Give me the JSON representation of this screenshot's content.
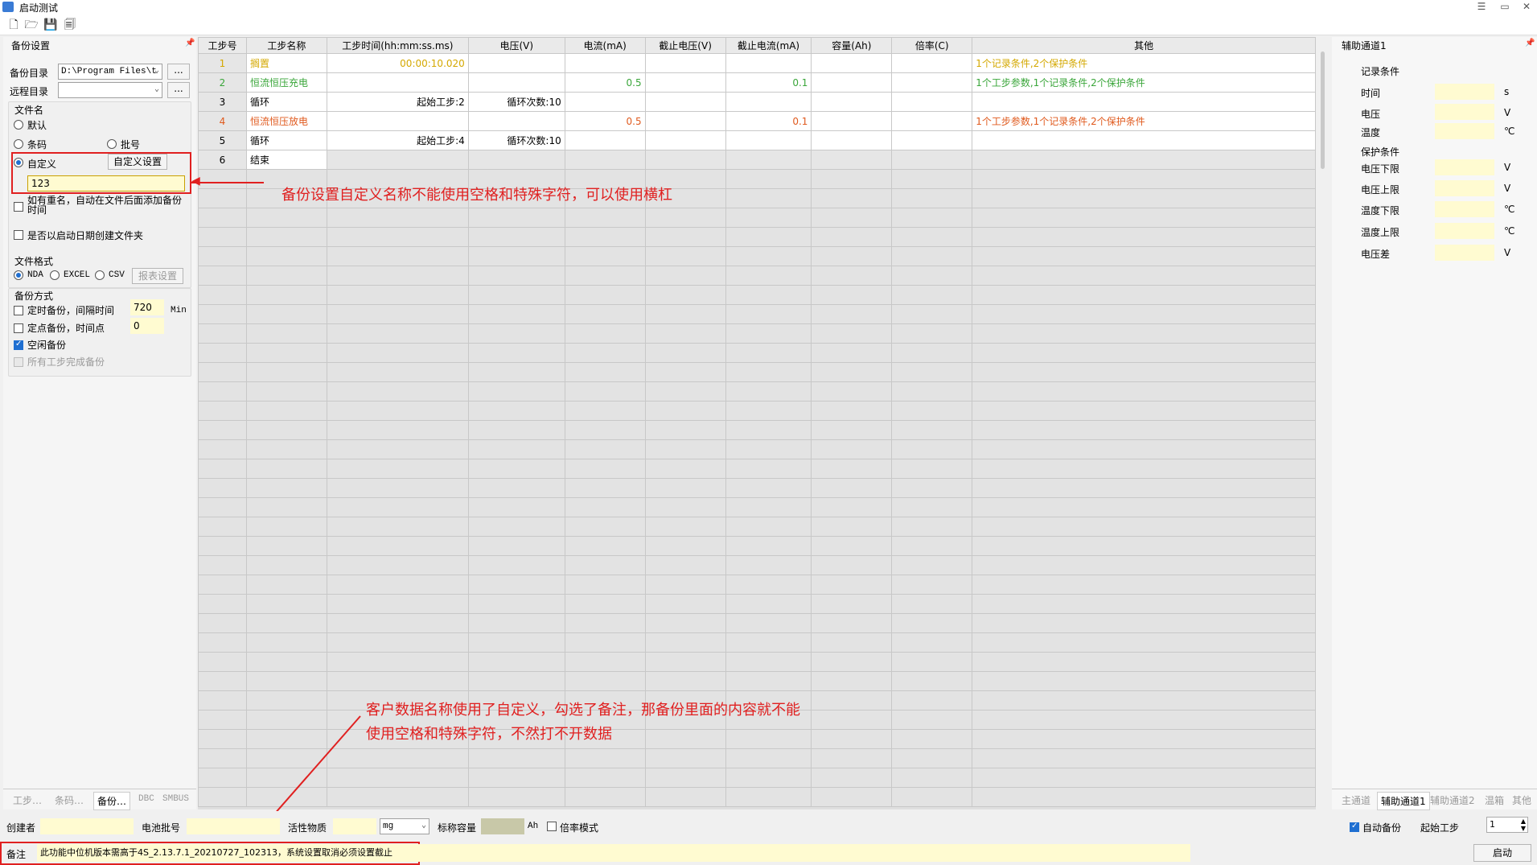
{
  "window": {
    "title": "启动测试",
    "controls": [
      "☰",
      "▭",
      "✕"
    ]
  },
  "toolbar": {
    "icons": [
      "new-icon",
      "open-icon",
      "save-icon",
      "save-all-icon"
    ]
  },
  "left": {
    "title": "备份设置",
    "pin": "📌",
    "backup_dir_label": "备份目录",
    "backup_dir_value": "D:\\Program Files\\t",
    "remote_dir_label": "远程目录",
    "remote_dir_value": "",
    "browse": "...",
    "filename_group": "文件名",
    "opt_default": "默认",
    "opt_barcode": "条码",
    "opt_batch": "批号",
    "opt_custom": "自定义",
    "custom_settings_btn": "自定义设置",
    "custom_value": "123",
    "rename_check": "如有重名，自动在文件后面添加备份时间",
    "date_folder_check": "是否以启动日期创建文件夹",
    "format_group": "文件格式",
    "fmt_nda": "NDA",
    "fmt_excel": "EXCEL",
    "fmt_csv": "CSV",
    "report_btn": "报表设置",
    "backup_mode_group": "备份方式",
    "timed_backup": "定时备份，间隔时间",
    "timed_value": "720",
    "timed_unit": "Min",
    "point_backup": "定点备份，时间点",
    "point_value": "0",
    "idle_backup": "空闲备份",
    "all_steps_backup": "所有工步完成备份",
    "tabs": [
      "工步…",
      "条码…",
      "备份…",
      "DBC",
      "SMBUS"
    ]
  },
  "grid": {
    "columns": [
      "工步号",
      "工步名称",
      "工步时间(hh:mm:ss.ms)",
      "电压(V)",
      "电流(mA)",
      "截止电压(V)",
      "截止电流(mA)",
      "容量(Ah)",
      "倍率(C)",
      "其他"
    ],
    "rows": [
      {
        "no": "1",
        "name": "搁置",
        "time": "00:00:10.020",
        "voltage": "",
        "current": "",
        "cut_v": "",
        "cut_i": "",
        "cap": "",
        "rate": "",
        "other": "1个记录条件,2个保护条件",
        "color": "#d4a800"
      },
      {
        "no": "2",
        "name": "恒流恒压充电",
        "time": "",
        "voltage": "",
        "current": "0.5",
        "cut_v": "",
        "cut_i": "0.1",
        "cap": "",
        "rate": "",
        "other": "1个工步参数,1个记录条件,2个保护条件",
        "color": "#3aa63a"
      },
      {
        "no": "3",
        "name": "循环",
        "time": "起始工步:2",
        "voltage": "循环次数:10",
        "current": "",
        "cut_v": "",
        "cut_i": "",
        "cap": "",
        "rate": "",
        "other": "",
        "color": "#000000"
      },
      {
        "no": "4",
        "name": "恒流恒压放电",
        "time": "",
        "voltage": "",
        "current": "0.5",
        "cut_v": "",
        "cut_i": "0.1",
        "cap": "",
        "rate": "",
        "other": "1个工步参数,1个记录条件,2个保护条件",
        "color": "#e05a1e"
      },
      {
        "no": "5",
        "name": "循环",
        "time": "起始工步:4",
        "voltage": "循环次数:10",
        "current": "",
        "cut_v": "",
        "cut_i": "",
        "cap": "",
        "rate": "",
        "other": "",
        "color": "#000000"
      },
      {
        "no": "6",
        "name": "结束",
        "time": "",
        "voltage": "",
        "current": "",
        "cut_v": "",
        "cut_i": "",
        "cap": "",
        "rate": "",
        "other": "",
        "color": "#000000"
      }
    ]
  },
  "annotations": {
    "note1": "备份设置自定义名称不能使用空格和特殊字符，可以使用横杠",
    "note2_line1": "客户数据名称使用了自定义，勾选了备注，那备份里面的内容就不能",
    "note2_line2": "使用空格和特殊字符，不然打不开数据"
  },
  "right": {
    "title": "辅助通道1",
    "record_cond": "记录条件",
    "time": "时间",
    "time_unit": "s",
    "voltage": "电压",
    "voltage_unit": "V",
    "temp": "温度",
    "temp_unit": "℃",
    "protect_cond": "保护条件",
    "v_low": "电压下限",
    "v_low_unit": "V",
    "v_high": "电压上限",
    "v_high_unit": "V",
    "t_low": "温度下限",
    "t_low_unit": "℃",
    "t_high": "温度上限",
    "t_high_unit": "℃",
    "v_diff": "电压差",
    "v_diff_unit": "V",
    "tabs": [
      "主通道",
      "辅助通道1",
      "辅助通道2",
      "温箱",
      "其他"
    ]
  },
  "bottom": {
    "creator": "创建者",
    "batch": "电池批号",
    "active": "活性物质",
    "active_unit": "mg",
    "capacity": "标称容量",
    "capacity_unit": "Ah",
    "rate_mode": "倍率模式",
    "auto_backup": "自动备份",
    "start_step": "起始工步",
    "start_step_value": "1",
    "start_btn": "启动",
    "remark_label": "备注",
    "remark_text": "此功能中位机版本需高于4S_2.13.7.1_20210727_102313，系统设置取消必须设置截止"
  },
  "colors": {
    "annotation_red": "#e02020",
    "field_yellow": "#fffbd1",
    "check_blue": "#1f6fd1"
  }
}
